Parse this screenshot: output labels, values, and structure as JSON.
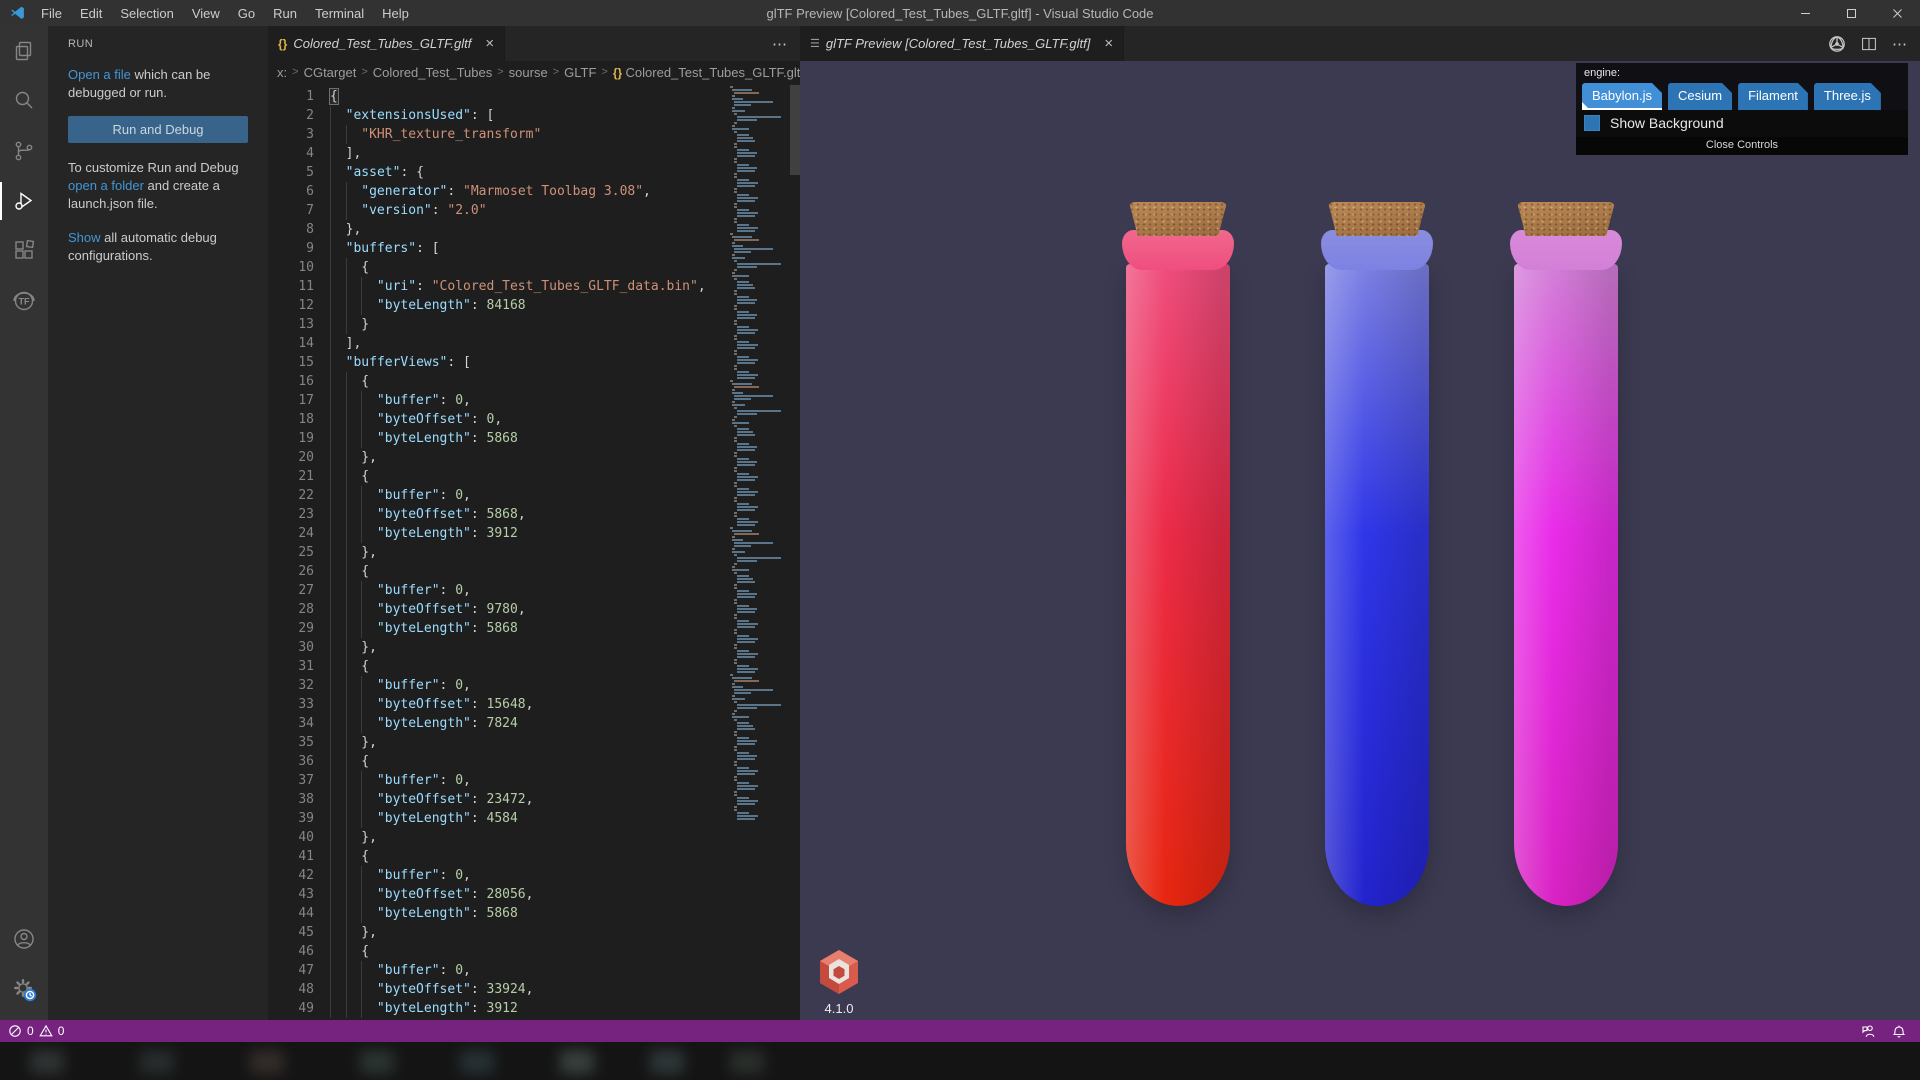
{
  "window": {
    "title": "glTF Preview [Colored_Test_Tubes_GLTF.gltf] - Visual Studio Code",
    "menu": [
      "File",
      "Edit",
      "Selection",
      "View",
      "Go",
      "Run",
      "Terminal",
      "Help"
    ]
  },
  "icons": {
    "json_braces": "{}",
    "close": "×",
    "more": "⋯",
    "preview_tab": "☰",
    "breadcrumb_separator": ">",
    "tf_label": "TF",
    "activity_bar": [
      "files",
      "search",
      "source-control",
      "run-and-debug",
      "extensions",
      "gltf-tools"
    ],
    "activity_bar_bottom": [
      "accounts",
      "settings-with-sync-badge"
    ]
  },
  "sidebar": {
    "heading": "RUN",
    "intro_link": "Open a file",
    "intro_rest": " which can be debugged or run.",
    "run_button": "Run and Debug",
    "customize_pre": "To customize Run and Debug ",
    "customize_link": "open a folder",
    "customize_post": " and create a launch.json file.",
    "show_link": "Show",
    "show_rest": " all automatic debug configurations."
  },
  "editor": {
    "tab_label": "Colored_Test_Tubes_GLTF.gltf",
    "breadcrumb": [
      "x:",
      "CGtarget",
      "Colored_Test_Tubes",
      "sourse",
      "GLTF",
      "Colored_Test_Tubes_GLTF.gltf"
    ],
    "start_line": 1,
    "code_lines": [
      "{",
      "  \"extensionsUsed\": [",
      "    \"KHR_texture_transform\"",
      "  ],",
      "  \"asset\": {",
      "    \"generator\": \"Marmoset Toolbag 3.08\",",
      "    \"version\": \"2.0\"",
      "  },",
      "  \"buffers\": [",
      "    {",
      "      \"uri\": \"Colored_Test_Tubes_GLTF_data.bin\",",
      "      \"byteLength\": 84168",
      "    }",
      "  ],",
      "  \"bufferViews\": [",
      "    {",
      "      \"buffer\": 0,",
      "      \"byteOffset\": 0,",
      "      \"byteLength\": 5868",
      "    },",
      "    {",
      "      \"buffer\": 0,",
      "      \"byteOffset\": 5868,",
      "      \"byteLength\": 3912",
      "    },",
      "    {",
      "      \"buffer\": 0,",
      "      \"byteOffset\": 9780,",
      "      \"byteLength\": 5868",
      "    },",
      "    {",
      "      \"buffer\": 0,",
      "      \"byteOffset\": 15648,",
      "      \"byteLength\": 7824",
      "    },",
      "    {",
      "      \"buffer\": 0,",
      "      \"byteOffset\": 23472,",
      "      \"byteLength\": 4584",
      "    },",
      "    {",
      "      \"buffer\": 0,",
      "      \"byteOffset\": 28056,",
      "      \"byteLength\": 5868",
      "    },",
      "    {",
      "      \"buffer\": 0,",
      "      \"byteOffset\": 33924,",
      "      \"byteLength\": 3912"
    ]
  },
  "preview": {
    "tab_label": "glTF Preview [Colored_Test_Tubes_GLTF.gltf]",
    "engine_label": "engine:",
    "engines": [
      {
        "label": "Babylon.js",
        "selected": true
      },
      {
        "label": "Cesium",
        "selected": false
      },
      {
        "label": "Filament",
        "selected": false
      },
      {
        "label": "Three.js",
        "selected": false
      }
    ],
    "show_background_label": "Show Background",
    "close_controls_label": "Close Controls",
    "engine_version": "4.1.0",
    "background_color": "#3c3a51",
    "tubes": [
      {
        "name": "red",
        "cork": "#bd8a57",
        "neck": "#f0688d",
        "top": "#ef4e7e",
        "mid": "#ec2b48",
        "bottom": "#e7260f"
      },
      {
        "name": "blue",
        "cork": "#bd8a57",
        "neck": "#8a8ede",
        "top": "#7d81e3",
        "mid": "#2f36e8",
        "bottom": "#2323cd"
      },
      {
        "name": "magenta",
        "cork": "#bd8a57",
        "neck": "#d98ad9",
        "top": "#d37fd8",
        "mid": "#e92ce9",
        "bottom": "#d922c4"
      }
    ]
  },
  "status_bar": {
    "errors": "0",
    "warnings": "0"
  },
  "colors": {
    "statusbar": "#76227f",
    "accent_blue": "#2d74b5",
    "accent_blue_selected": "#418fd6",
    "link": "#4296d6"
  }
}
